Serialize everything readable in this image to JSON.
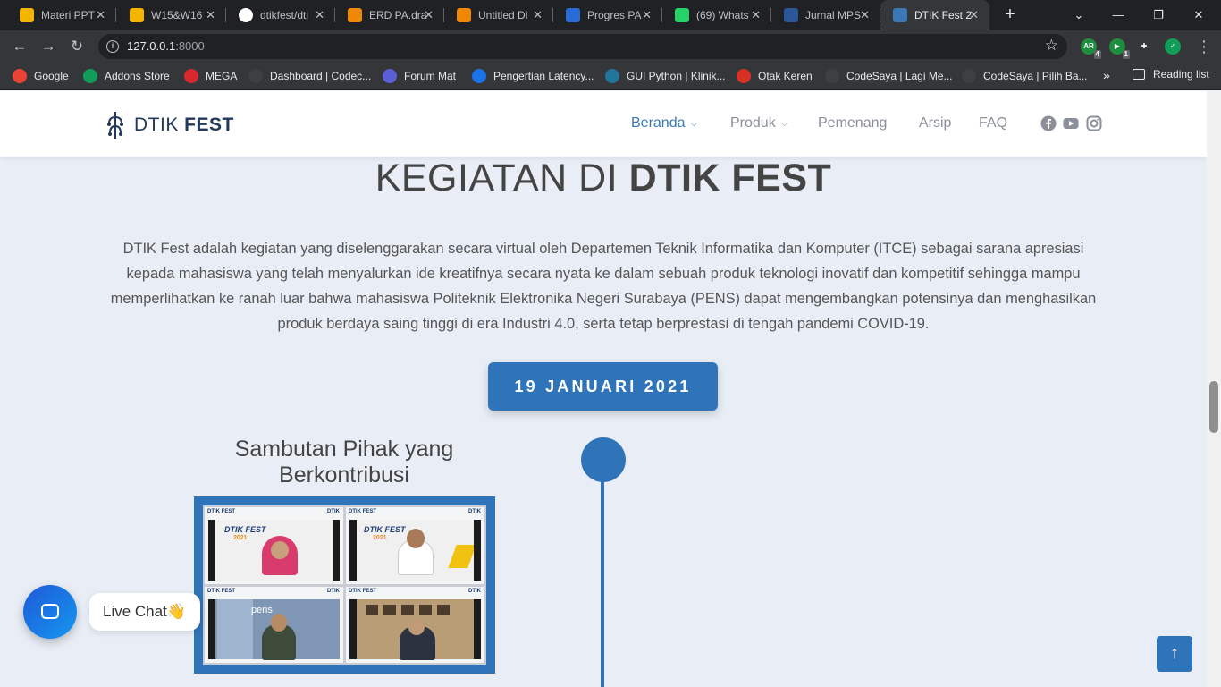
{
  "browser": {
    "tabs": [
      {
        "label": "Materi PPT",
        "favicon": "google-drive-icon",
        "color": "#f4b400",
        "active": false
      },
      {
        "label": "W15&W16",
        "favicon": "google-slides-icon",
        "color": "#f4b400",
        "active": false
      },
      {
        "label": "dtikfest/dti",
        "favicon": "github-icon",
        "color": "#ffffff",
        "active": false
      },
      {
        "label": "ERD PA.dra",
        "favicon": "drawio-icon",
        "color": "#f08705",
        "active": false
      },
      {
        "label": "Untitled Di",
        "favicon": "drawio-icon",
        "color": "#f08705",
        "active": false
      },
      {
        "label": "Progres PA",
        "favicon": "canva-icon",
        "color": "#2a6cd6",
        "active": false
      },
      {
        "label": "(69) Whats",
        "favicon": "whatsapp-icon",
        "color": "#25d366",
        "active": false
      },
      {
        "label": "Jurnal MPS",
        "favicon": "word-icon",
        "color": "#2b579a",
        "active": false
      },
      {
        "label": "DTIK Fest 2",
        "favicon": "dtik-icon",
        "color": "#3b78b8",
        "active": true
      }
    ],
    "url_host": "127.0.0.1",
    "url_port": ":8000",
    "extensions": [
      {
        "name": "ar-extension-icon",
        "text": "AR",
        "badge": "4",
        "color": "#1e8e3e"
      },
      {
        "name": "video-extension-icon",
        "text": "▶",
        "badge": "1",
        "color": "#1e8e3e"
      },
      {
        "name": "puzzle-extension-icon",
        "text": "✚",
        "badge": "",
        "color": "#35363a"
      },
      {
        "name": "shield-extension-icon",
        "text": "✓",
        "badge": "",
        "color": "#0f9d58"
      }
    ],
    "bookmarks": [
      {
        "label": "Google",
        "icon": "google-icon",
        "color": "#ea4335"
      },
      {
        "label": "Addons Store",
        "icon": "addons-store-icon",
        "color": "#0f9d58"
      },
      {
        "label": "MEGA",
        "icon": "mega-icon",
        "color": "#d9272e"
      },
      {
        "label": "Dashboard | Codec...",
        "icon": "codec-icon",
        "color": "#3c4043"
      },
      {
        "label": "Forum Mat",
        "icon": "forum-icon",
        "color": "#5a5fd6"
      },
      {
        "label": "Pengertian Latency...",
        "icon": "latency-icon",
        "color": "#1a73e8"
      },
      {
        "label": "GUI Python | Klinik...",
        "icon": "wordpress-icon",
        "color": "#21759b"
      },
      {
        "label": "Otak Keren",
        "icon": "otak-keren-icon",
        "color": "#d93025"
      },
      {
        "label": "CodeSaya | Lagi Me...",
        "icon": "codesaya-icon",
        "color": "#3c4043"
      },
      {
        "label": "CodeSaya | Pilih Ba...",
        "icon": "codesaya-icon",
        "color": "#3c4043"
      }
    ],
    "bookmarks_more": "»",
    "reading_list": "Reading list"
  },
  "site": {
    "logo_light": "DTIK ",
    "logo_bold": "FEST",
    "nav": [
      {
        "label": "Beranda",
        "has_dropdown": true,
        "active": true
      },
      {
        "label": "Produk",
        "has_dropdown": true,
        "active": false
      },
      {
        "label": "Pemenang",
        "has_dropdown": false,
        "active": false
      },
      {
        "label": "Arsip",
        "has_dropdown": false,
        "active": false
      },
      {
        "label": "FAQ",
        "has_dropdown": false,
        "active": false
      }
    ],
    "social": [
      "facebook-icon",
      "youtube-icon",
      "instagram-icon"
    ],
    "brand_color": "#2f73b9"
  },
  "main": {
    "headline_light": "KEGIATAN DI ",
    "headline_bold": "DTIK FEST",
    "intro": "DTIK Fest adalah kegiatan yang diselenggarakan secara virtual oleh Departemen Teknik Informatika dan Komputer (ITCE) sebagai sarana apresiasi kepada mahasiswa yang telah menyalurkan ide kreatifnya secara nyata ke dalam sebuah produk teknologi inovatif dan kompetitif sehingga mampu memperlihatkan ke ranah luar bahwa mahasiswa Politeknik Elektronika Negeri Surabaya (PENS) dapat mengembangkan potensinya dan menghasilkan produk berdaya saing tinggi di era Industri 4.0, serta tetap berprestasi di tengah pandemi COVID-19.",
    "date": "19 JANUARI 2021",
    "event_title": "Sambutan Pihak yang Berkontribusi",
    "photo_banner": "DTIK FEST",
    "photo_year": "2021",
    "photo_tag": "DTIK",
    "photo_campus": "pens"
  },
  "widgets": {
    "live_chat": "Live Chat👋",
    "back_to_top": "↑"
  }
}
